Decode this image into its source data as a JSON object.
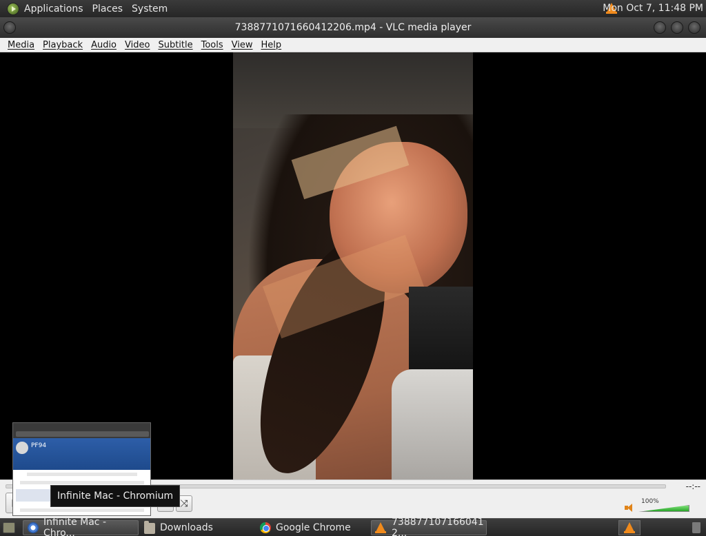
{
  "top_panel": {
    "menus": [
      "Applications",
      "Places",
      "System"
    ],
    "clock": "Mon Oct  7, 11:48 PM"
  },
  "window": {
    "title": "7388771071660412206.mp4 - VLC media player"
  },
  "menubar": [
    "Media",
    "Playback",
    "Audio",
    "Video",
    "Subtitle",
    "Tools",
    "View",
    "Help"
  ],
  "controls": {
    "time": "--:--",
    "volume_percent": "100%",
    "volume_level": 1.0,
    "buttons": [
      "play-icon",
      "stop-icon",
      "fullscreen-icon",
      "playlist-icon",
      "extended-settings-icon",
      "loop-icon",
      "shuffle-icon"
    ]
  },
  "taskbar": {
    "tasks": [
      {
        "label": "Infinite Mac - Chro...",
        "icon": "chromium-icon"
      },
      {
        "label": "Downloads",
        "icon": "folder-icon"
      },
      {
        "label": "Google Chrome",
        "icon": "chrome-icon"
      },
      {
        "label": "738877107166041 2...",
        "icon": "vlc-icon"
      }
    ]
  },
  "preview": {
    "title": "PF94",
    "tooltip": "Infinite Mac - Chromium"
  }
}
